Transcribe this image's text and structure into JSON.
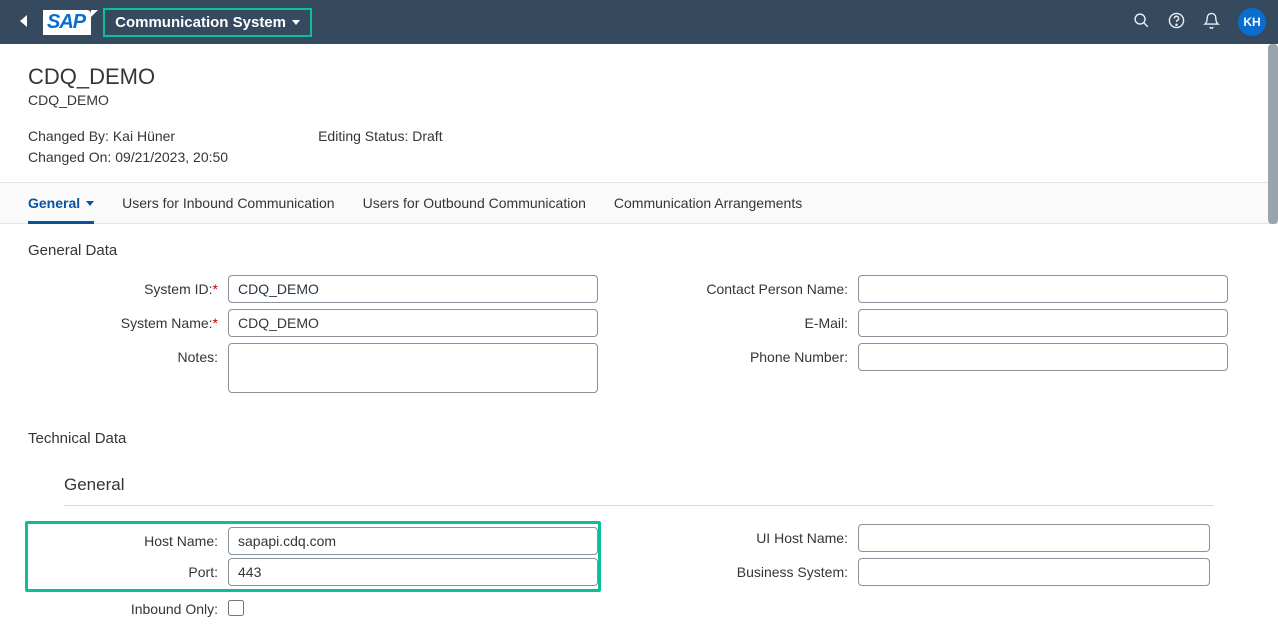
{
  "shell": {
    "app_title": "Communication System",
    "logo_text": "SAP",
    "user_initials": "KH"
  },
  "header": {
    "title": "CDQ_DEMO",
    "subtitle": "CDQ_DEMO",
    "changed_by_label": "Changed By:",
    "changed_by_value": "Kai Hüner",
    "changed_on_label": "Changed On:",
    "changed_on_value": "09/21/2023, 20:50",
    "editing_status_label": "Editing Status:",
    "editing_status_value": "Draft"
  },
  "tabs": {
    "general": "General",
    "inbound": "Users for Inbound Communication",
    "outbound": "Users for Outbound Communication",
    "arrangements": "Communication Arrangements"
  },
  "sections": {
    "general_data": "General Data",
    "technical_data": "Technical Data",
    "general_sub": "General"
  },
  "fields": {
    "system_id": {
      "label": "System ID:",
      "value": "CDQ_DEMO"
    },
    "system_name": {
      "label": "System Name:",
      "value": "CDQ_DEMO"
    },
    "notes": {
      "label": "Notes:",
      "value": ""
    },
    "contact": {
      "label": "Contact Person Name:",
      "value": ""
    },
    "email": {
      "label": "E-Mail:",
      "value": ""
    },
    "phone": {
      "label": "Phone Number:",
      "value": ""
    },
    "host_name": {
      "label": "Host Name:",
      "value": "sapapi.cdq.com"
    },
    "port": {
      "label": "Port:",
      "value": "443"
    },
    "inbound_only": {
      "label": "Inbound Only:"
    },
    "ui_host": {
      "label": "UI Host Name:",
      "value": ""
    },
    "business_system": {
      "label": "Business System:",
      "value": ""
    }
  }
}
